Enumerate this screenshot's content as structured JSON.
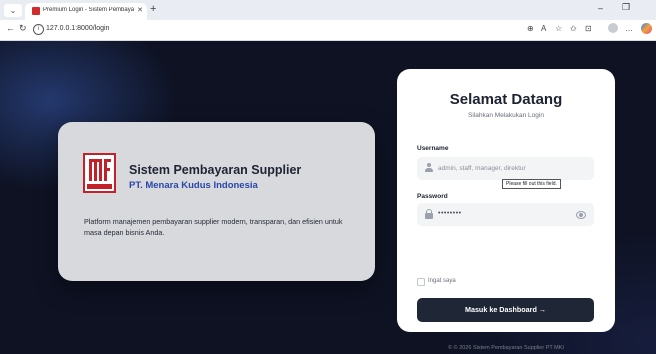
{
  "browser": {
    "tab_title": "Premium Login - Sistem Pembaya",
    "url": "127.0.0.1:8000/login",
    "colors": {
      "favicon": "#d12b2b"
    }
  },
  "brand": {
    "title": "Sistem Pembayaran Supplier",
    "subtitle": "PT. Menara Kudus Indonesia",
    "description": "Platform manajemen pembayaran supplier modern, transparan, dan efisien untuk masa depan bisnis Anda.",
    "logo_icon": "menara-kudus-logo"
  },
  "login": {
    "heading": "Selamat Datang",
    "subheading": "Silahkan Melakukan Login",
    "username_label": "Username",
    "username_placeholder": "admin, staff, manager, direktur",
    "validation_tooltip": "Please fill out this field.",
    "password_label": "Password",
    "password_value": "••••••••",
    "remember_label": "Ingat saya",
    "submit_label": "Masuk ke Dashboard →",
    "footer": "© © 2026 Sistem Pembayaran Supplier PT MKI"
  },
  "colors": {
    "page_background": "#0e1223",
    "button": "#1f2635",
    "brand_accent": "#2a47a8",
    "logo_red": "#c3202a"
  }
}
